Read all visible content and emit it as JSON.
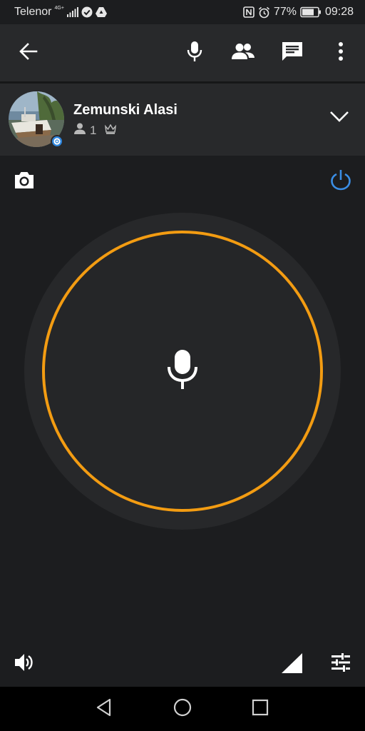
{
  "status_bar": {
    "carrier": "Telenor",
    "network_type": "4G+",
    "battery": "77%",
    "time": "09:28",
    "icons": [
      "signal-icon",
      "check-circle-icon",
      "drive-icon",
      "nfc-icon",
      "alarm-icon",
      "battery-icon"
    ]
  },
  "toolbar": {
    "icons": [
      "back-arrow-icon",
      "microphone-icon",
      "people-icon",
      "chat-icon",
      "more-vert-icon"
    ],
    "active_tab": "talk",
    "accent_color": "#f39c12"
  },
  "channel": {
    "name": "Zemunski Alasi",
    "user_count": "1",
    "icons": [
      "person-icon",
      "crown-icon",
      "chevron-down-icon"
    ],
    "badge_color": "#2e86de"
  },
  "talk_area": {
    "icons": [
      "camera-icon",
      "power-icon",
      "microphone-icon"
    ],
    "power_color": "#3a8ee6",
    "ring_color": "#f39c12"
  },
  "bottom_controls": {
    "icons": [
      "speaker-icon",
      "signal-strength-icon",
      "tune-icon"
    ]
  },
  "nav_bar": {
    "icons": [
      "back-triangle-icon",
      "home-circle-icon",
      "recents-square-icon"
    ]
  }
}
